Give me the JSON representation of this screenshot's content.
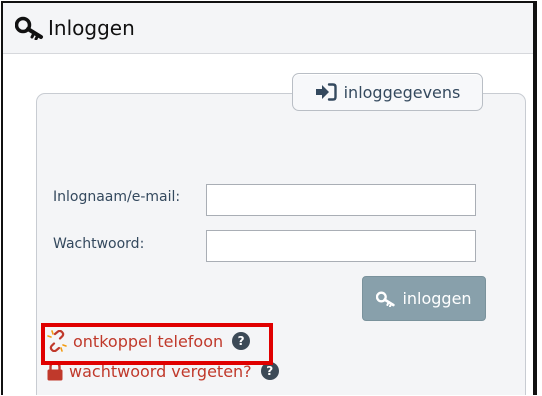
{
  "header": {
    "title": "Inloggen",
    "icon": "key-icon"
  },
  "form": {
    "legend_button": {
      "label": "inloggegevens",
      "icon": "sign-in-icon"
    },
    "username_label": "Inlognaam/e-mail:",
    "username_value": "",
    "password_label": "Wachtwoord:",
    "password_value": "",
    "submit": {
      "label": "inloggen",
      "icon": "key-icon"
    }
  },
  "links": {
    "unlink_phone": {
      "label": "ontkoppel telefoon",
      "icon": "broken-link-icon",
      "help": "?"
    },
    "forgot_password": {
      "label": "wachtwoord vergeten?",
      "icon": "lock-icon",
      "help": "?"
    }
  },
  "colors": {
    "link": "#c0392b",
    "highlight": "#e00000",
    "button_bg": "#88a0ab",
    "panel_bg": "#f4f5f7"
  }
}
